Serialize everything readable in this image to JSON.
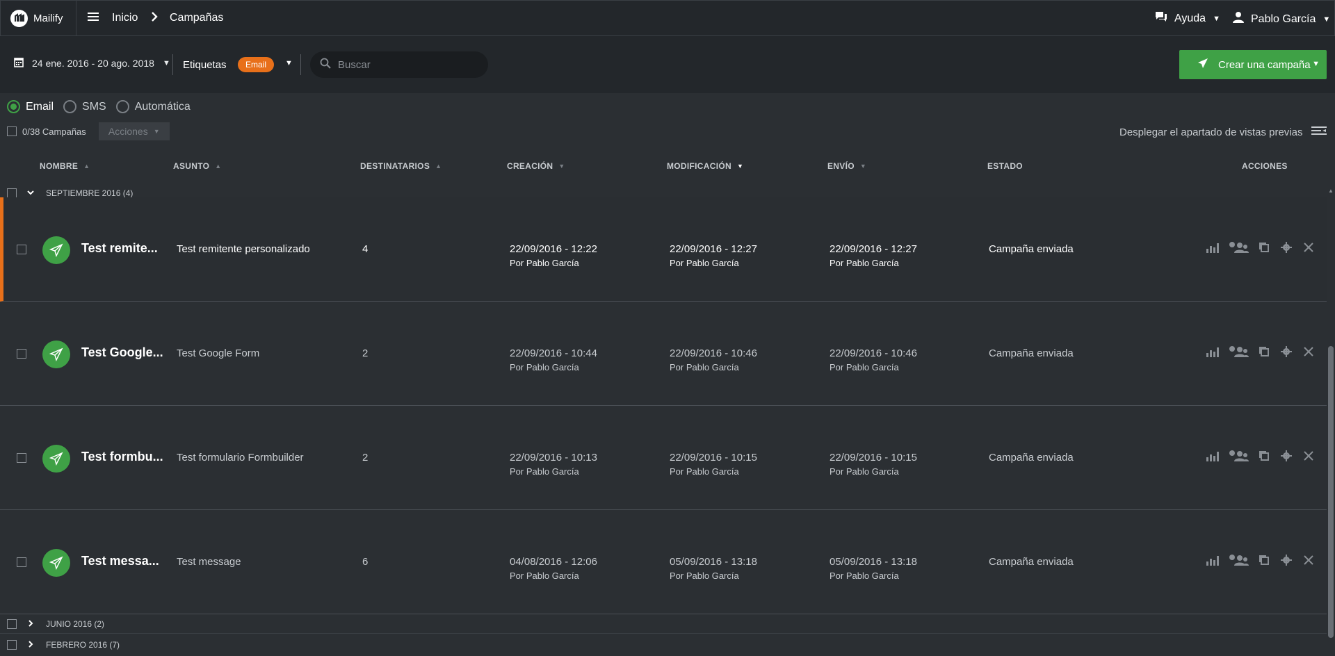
{
  "app": {
    "name": "Mailify"
  },
  "breadcrumb": {
    "home": "Inicio",
    "current": "Campañas"
  },
  "topbar": {
    "help_label": "Ayuda",
    "user_name": "Pablo García"
  },
  "filters": {
    "date_range": "24 ene. 2016 - 20 ago. 2018",
    "tags_label": "Etiquetas",
    "tag_pill": "Email",
    "search_placeholder": "Buscar",
    "create_label": "Crear una campaña"
  },
  "types": {
    "email": "Email",
    "sms": "SMS",
    "auto": "Automática"
  },
  "selection": {
    "count_label": "0/38 Campañas",
    "actions_label": "Acciones"
  },
  "preview_toggle_label": "Desplegar el apartado de vistas previas",
  "columns": {
    "name": "NOMBRE",
    "subject": "ASUNTO",
    "recipients": "DESTINATARIOS",
    "created": "CREACIÓN",
    "modified": "MODIFICACIÓN",
    "sent": "ENVÍO",
    "status": "ESTADO",
    "actions": "ACCIONES"
  },
  "groups": [
    {
      "label": "SEPTIEMBRE 2016 (4)"
    },
    {
      "label": "JUNIO 2016 (2)"
    },
    {
      "label": "FEBRERO 2016 (7)"
    }
  ],
  "rows": [
    {
      "name": "Test remite...",
      "subject": "Test remitente personalizado",
      "recipients": "4",
      "created": "22/09/2016 - 12:22",
      "created_by": "Por Pablo García",
      "modified": "22/09/2016 - 12:27",
      "modified_by": "Por Pablo García",
      "sent": "22/09/2016 - 12:27",
      "sent_by": "Por Pablo García",
      "status": "Campaña enviada"
    },
    {
      "name": "Test Google...",
      "subject": "Test Google Form",
      "recipients": "2",
      "created": "22/09/2016 - 10:44",
      "created_by": "Por Pablo García",
      "modified": "22/09/2016 - 10:46",
      "modified_by": "Por Pablo García",
      "sent": "22/09/2016 - 10:46",
      "sent_by": "Por Pablo García",
      "status": "Campaña enviada"
    },
    {
      "name": "Test formbu...",
      "subject": "Test formulario Formbuilder",
      "recipients": "2",
      "created": "22/09/2016 - 10:13",
      "created_by": "Por Pablo García",
      "modified": "22/09/2016 - 10:15",
      "modified_by": "Por Pablo García",
      "sent": "22/09/2016 - 10:15",
      "sent_by": "Por Pablo García",
      "status": "Campaña enviada"
    },
    {
      "name": "Test messa...",
      "subject": "Test message",
      "recipients": "6",
      "created": "04/08/2016 - 12:06",
      "created_by": "Por Pablo García",
      "modified": "05/09/2016 - 13:18",
      "modified_by": "Por Pablo García",
      "sent": "05/09/2016 - 13:18",
      "sent_by": "Por Pablo García",
      "status": "Campaña enviada"
    }
  ],
  "colors": {
    "accent_green": "#3fa146",
    "accent_orange": "#e8701a",
    "bg_dark": "#23272b",
    "bg_list": "#2b2f33"
  },
  "icons": [
    "menu-icon",
    "chevron-right-icon",
    "chat-icon",
    "user-icon",
    "calendar-icon",
    "search-icon",
    "send-icon",
    "preview-panel-icon",
    "stats-icon",
    "recipients-icon",
    "duplicate-icon",
    "settings-icon",
    "delete-icon"
  ]
}
